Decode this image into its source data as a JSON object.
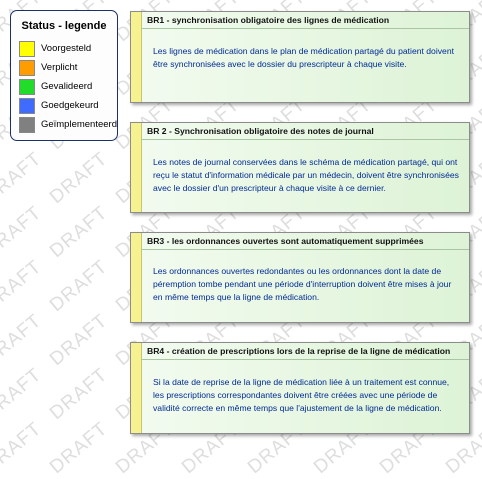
{
  "legend": {
    "title": "Status - legende",
    "items": [
      {
        "label": "Voorgesteld",
        "color": "#ffff00"
      },
      {
        "label": "Verplicht",
        "color": "#ff9d00"
      },
      {
        "label": "Gevalideerd",
        "color": "#22dc2a"
      },
      {
        "label": "Goedgekeurd",
        "color": "#3f6bff"
      },
      {
        "label": "Geïmplementeerd",
        "color": "#808080"
      }
    ]
  },
  "rules": [
    {
      "title": "BR1 - synchronisation obligatoire des lignes de médication",
      "text": "Les lignes de médication dans le plan de médication partagé du patient doivent être synchronisées avec le dossier du prescripteur à chaque visite."
    },
    {
      "title": "BR 2 - Synchronisation obligatoire des notes de journal",
      "text": "Les notes de journal conservées dans le schéma de médication partagé, qui ont reçu le statut d'information médicale par un médecin, doivent être synchronisées avec le dossier d'un prescripteur à chaque visite à ce dernier."
    },
    {
      "title": "BR3 - les ordonnances ouvertes sont automatiquement supprimées",
      "text": "Les ordonnances ouvertes redondantes ou les ordonnances dont la date de péremption tombe pendant une période d'interruption doivent être mises à jour en même temps que la ligne de médication."
    },
    {
      "title": "BR4 - création de prescriptions lors de la reprise de la ligne de médication",
      "text": "Si la date de reprise de la ligne de médication liée à un traitement est connue, les prescriptions correspondantes doivent être créées avec une période de validité correcte en même temps que l'ajustement de la ligne de médication."
    }
  ],
  "watermark": "DRAFT"
}
